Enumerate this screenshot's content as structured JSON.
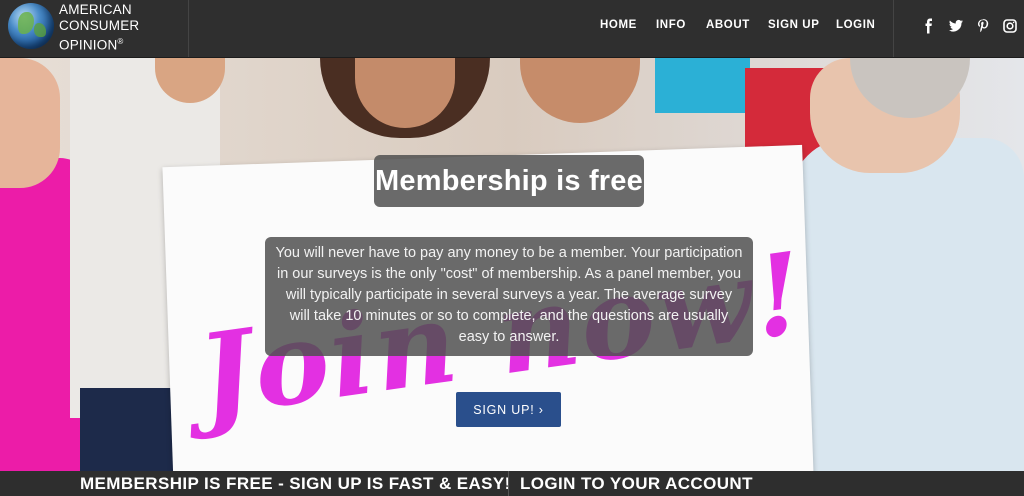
{
  "brand": {
    "line1": "AMERICAN",
    "line2": "CONSUMER",
    "line3": "OPINION",
    "registered": "®"
  },
  "nav": {
    "items": [
      {
        "label": "HOME"
      },
      {
        "label": "INFO"
      },
      {
        "label": "ABOUT"
      },
      {
        "label": "SIGN UP"
      },
      {
        "label": "LOGIN"
      }
    ]
  },
  "social": {
    "icons": [
      "facebook-icon",
      "twitter-icon",
      "pinterest-icon",
      "instagram-icon"
    ]
  },
  "hero": {
    "heading": "Membership is free",
    "body": "You will never have to pay any money to be a member. Your participation in our surveys is the only \"cost\" of membership. As a panel member, you will typically participate in several surveys a year. The average survey will take 10 minutes or so to complete, and the questions are usually easy to answer.",
    "sign_text": "Join now!",
    "button_label": "SIGN UP! ›"
  },
  "bottom": {
    "left_label": "MEMBERSHIP IS FREE - SIGN UP IS FAST & EASY!",
    "right_label": "LOGIN TO YOUR ACCOUNT"
  },
  "colors": {
    "navbar": "#2f2f2f",
    "button": "#2a4f8c",
    "sign_text": "#e21fe0",
    "overlay": "#505050"
  }
}
